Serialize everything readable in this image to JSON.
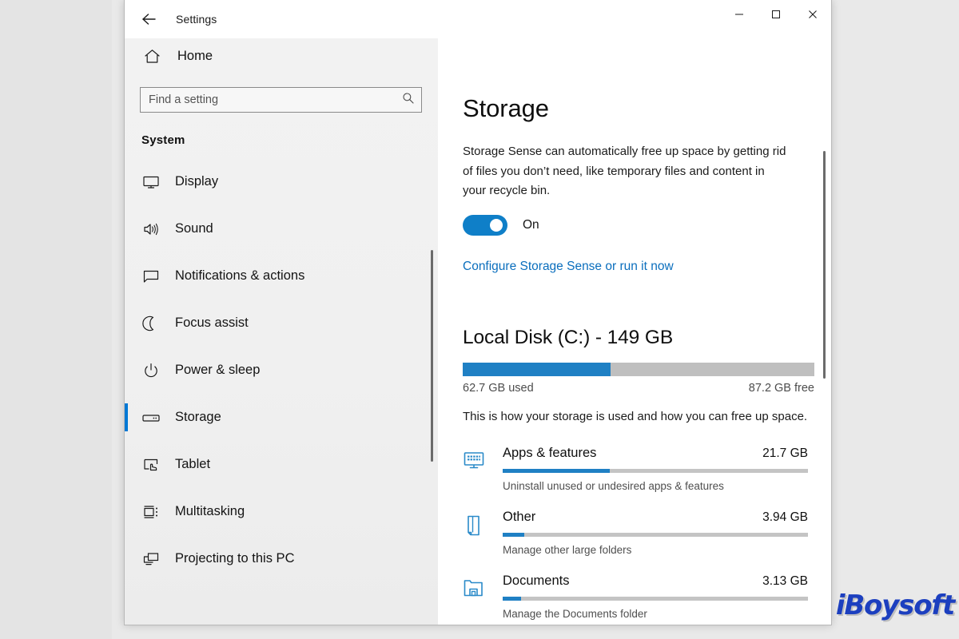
{
  "window": {
    "title": "Settings",
    "back_icon": "back-arrow-icon",
    "minimize_label": "—",
    "maximize_label": "☐",
    "close_label": "✕"
  },
  "sidebar": {
    "home_label": "Home",
    "home_icon": "home-icon",
    "search": {
      "placeholder": "Find a setting",
      "value": "",
      "icon": "search-icon"
    },
    "section_title": "System",
    "items": [
      {
        "label": "Display",
        "icon": "monitor-icon",
        "selected": false
      },
      {
        "label": "Sound",
        "icon": "speaker-icon",
        "selected": false
      },
      {
        "label": "Notifications & actions",
        "icon": "chat-bubble-icon",
        "selected": false
      },
      {
        "label": "Focus assist",
        "icon": "moon-icon",
        "selected": false
      },
      {
        "label": "Power & sleep",
        "icon": "power-icon",
        "selected": false
      },
      {
        "label": "Storage",
        "icon": "drive-icon",
        "selected": true
      },
      {
        "label": "Tablet",
        "icon": "tablet-hand-icon",
        "selected": false
      },
      {
        "label": "Multitasking",
        "icon": "multitasking-icon",
        "selected": false
      },
      {
        "label": "Projecting to this PC",
        "icon": "projecting-icon",
        "selected": false
      }
    ]
  },
  "main": {
    "page_title": "Storage",
    "storage_sense_description": "Storage Sense can automatically free up space by getting rid of files you don’t need, like temporary files and content in your recycle bin.",
    "toggle": {
      "state_label": "On",
      "is_on": true
    },
    "configure_link": "Configure Storage Sense or run it now",
    "disk": {
      "title": "Local Disk (C:) - 149 GB",
      "used_label": "62.7 GB used",
      "free_label": "87.2 GB free",
      "used_percent": 42,
      "usage_description": "This is how your storage is used and how you can free up space."
    },
    "categories": [
      {
        "name": "Apps & features",
        "size": "21.7 GB",
        "subtitle": "Uninstall unused or undesired apps & features",
        "percent": 35,
        "icon": "apps-monitor-icon"
      },
      {
        "name": "Other",
        "size": "3.94 GB",
        "subtitle": "Manage other large folders",
        "percent": 7,
        "icon": "page-icon"
      },
      {
        "name": "Documents",
        "size": "3.13 GB",
        "subtitle": "Manage the Documents folder",
        "percent": 6,
        "icon": "documents-folder-icon"
      }
    ]
  },
  "watermark": {
    "text": "iBoysoft"
  },
  "colors": {
    "accent": "#0078d4",
    "bar_fill": "#1f80c4",
    "bar_track": "#c4c4c4",
    "link": "#0a6ebd",
    "icon_blue": "#2a8ac9"
  }
}
